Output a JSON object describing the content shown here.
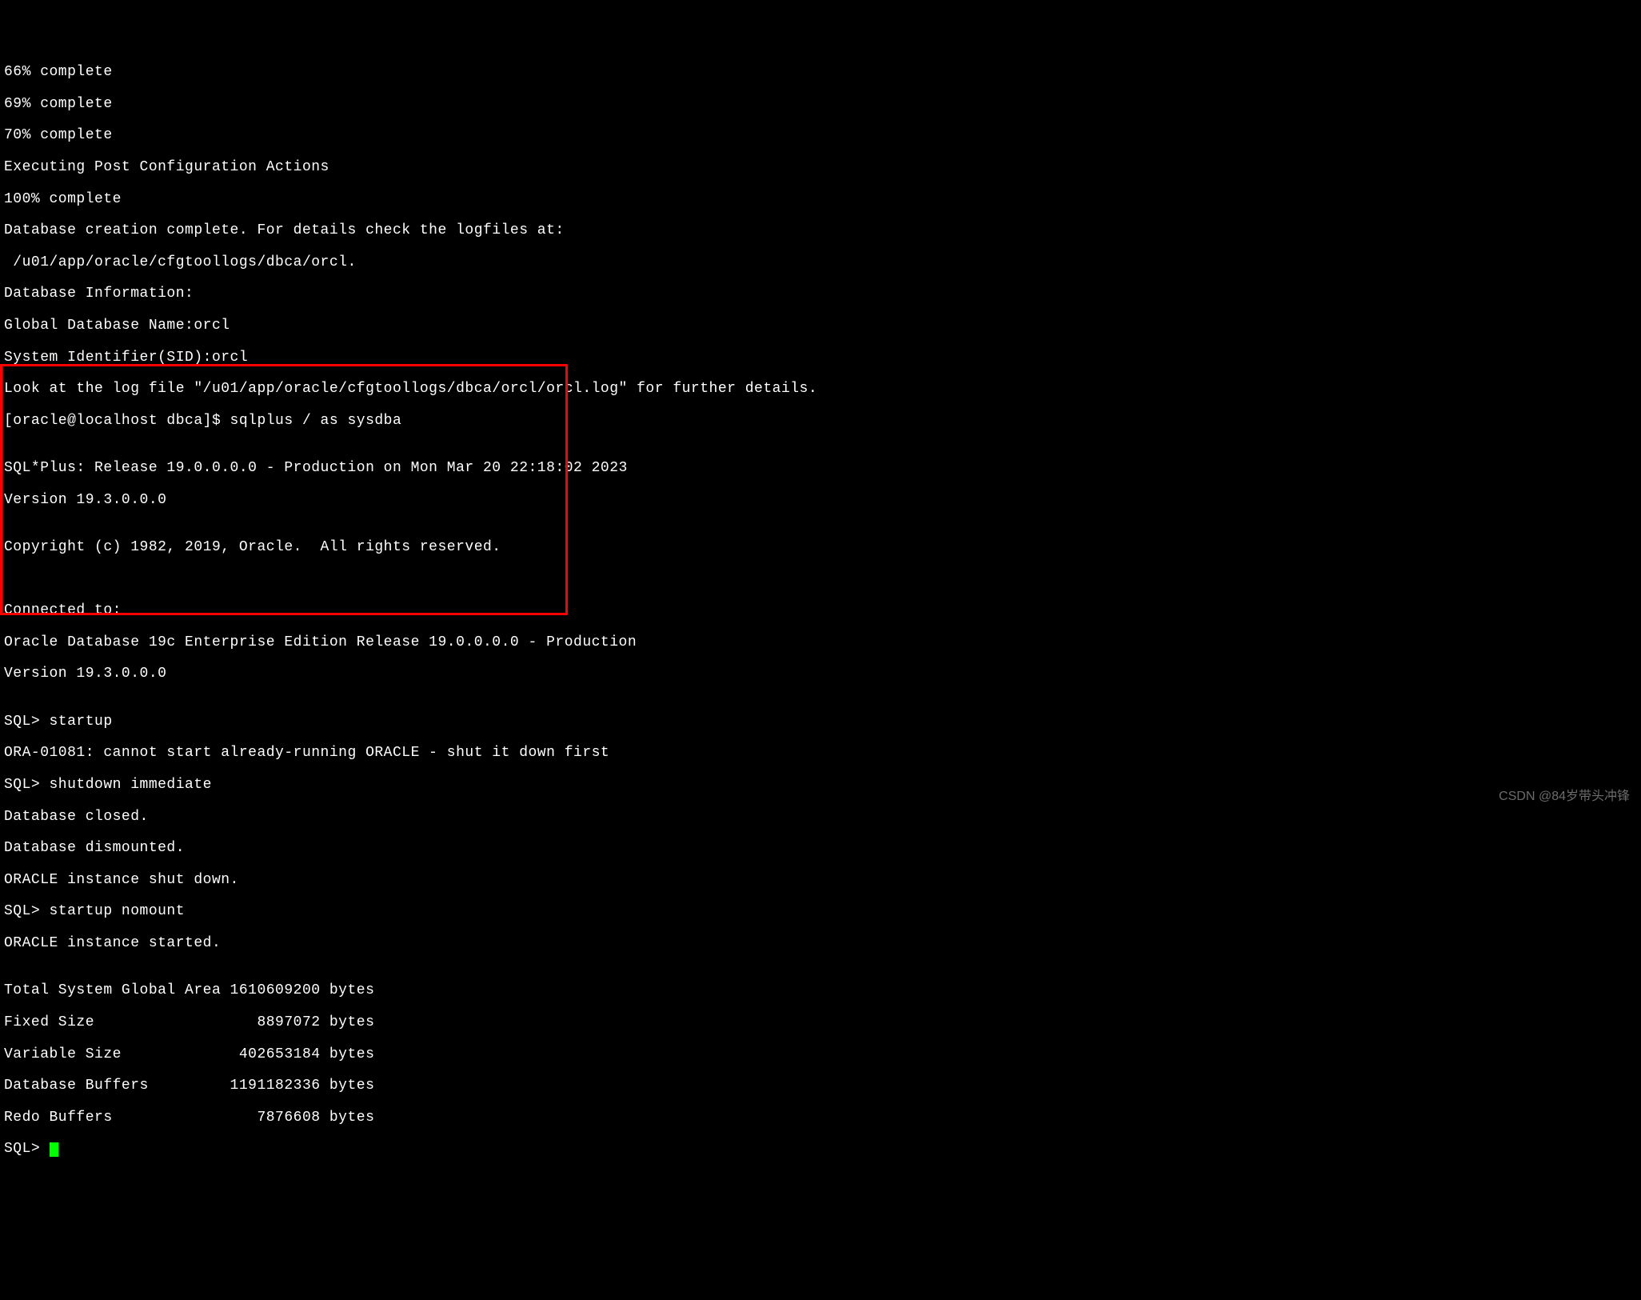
{
  "terminal": {
    "lines": {
      "l0": "66% complete",
      "l1": "69% complete",
      "l2": "70% complete",
      "l3": "Executing Post Configuration Actions",
      "l4": "100% complete",
      "l5": "Database creation complete. For details check the logfiles at:",
      "l6": " /u01/app/oracle/cfgtoollogs/dbca/orcl.",
      "l7": "Database Information:",
      "l8": "Global Database Name:orcl",
      "l9": "System Identifier(SID):orcl",
      "l10": "Look at the log file \"/u01/app/oracle/cfgtoollogs/dbca/orcl/orcl.log\" for further details.",
      "l11": "[oracle@localhost dbca]$ sqlplus / as sysdba",
      "l12": "",
      "l13": "SQL*Plus: Release 19.0.0.0.0 - Production on Mon Mar 20 22:18:02 2023",
      "l14": "Version 19.3.0.0.0",
      "l15": "",
      "l16": "Copyright (c) 1982, 2019, Oracle.  All rights reserved.",
      "l17": "",
      "l18": "",
      "l19": "Connected to:",
      "l20": "Oracle Database 19c Enterprise Edition Release 19.0.0.0.0 - Production",
      "l21": "Version 19.3.0.0.0",
      "l22": "",
      "l23": "SQL> startup",
      "l24": "ORA-01081: cannot start already-running ORACLE - shut it down first",
      "l25": "SQL> shutdown immediate",
      "l26": "Database closed.",
      "l27": "Database dismounted.",
      "l28": "ORACLE instance shut down.",
      "l29": "SQL> startup nomount",
      "l30": "ORACLE instance started.",
      "l31": "",
      "l32": "Total System Global Area 1610609200 bytes",
      "l33": "Fixed Size                  8897072 bytes",
      "l34": "Variable Size             402653184 bytes",
      "l35": "Database Buffers         1191182336 bytes",
      "l36": "Redo Buffers                7876608 bytes",
      "l37": "SQL> "
    }
  },
  "watermark": "CSDN @84岁带头冲锋"
}
